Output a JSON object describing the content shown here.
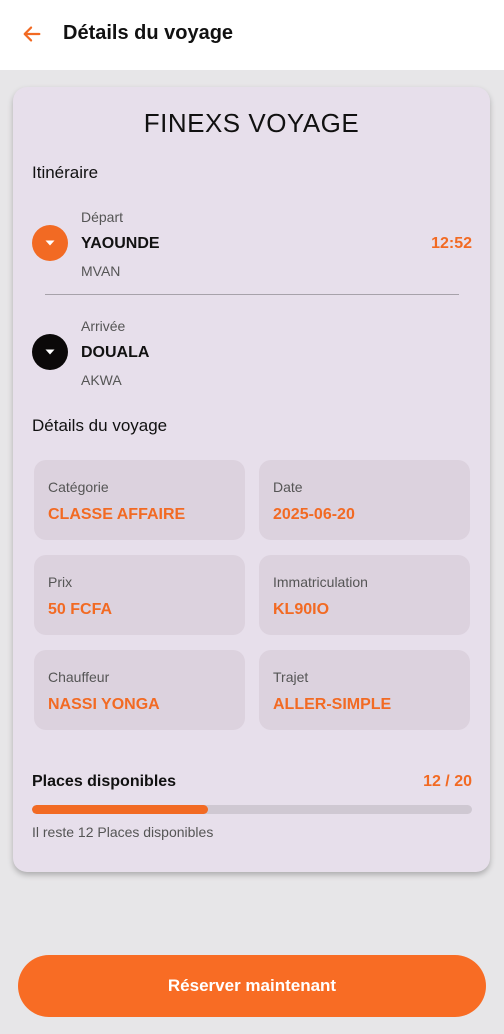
{
  "header": {
    "back_icon": "arrow-left-icon",
    "title": "Détails du voyage",
    "accent_color": "#f26a23"
  },
  "company": "FINEXS VOYAGE",
  "itinerary": {
    "title": "Itinéraire",
    "departure": {
      "caption": "Départ",
      "city": "YAOUNDE",
      "station": "MVAN",
      "time": "12:52",
      "icon": "chevron-down-icon",
      "dot_color": "#f26a23"
    },
    "arrival": {
      "caption": "Arrivée",
      "city": "DOUALA",
      "station": "AKWA",
      "icon": "chevron-down-icon",
      "dot_color": "#0b0909"
    }
  },
  "details": {
    "title": "Détails du voyage",
    "items": [
      {
        "label": "Catégorie",
        "value": "CLASSE AFFAIRE"
      },
      {
        "label": "Date",
        "value": "2025-06-20"
      },
      {
        "label": "Prix",
        "value": "50 FCFA"
      },
      {
        "label": "Immatriculation",
        "value": "KL90IO"
      },
      {
        "label": "Chauffeur",
        "value": "NASSI YONGA"
      },
      {
        "label": "Trajet",
        "value": "ALLER-SIMPLE"
      }
    ]
  },
  "places": {
    "label": "Places disponibles",
    "count_text": "12 / 20",
    "available": 12,
    "total": 20,
    "progress_fraction": 0.4,
    "note": "Il reste 12 Places disponibles"
  },
  "actions": {
    "book_label": "Réserver maintenant",
    "button_color": "#f86c24"
  }
}
